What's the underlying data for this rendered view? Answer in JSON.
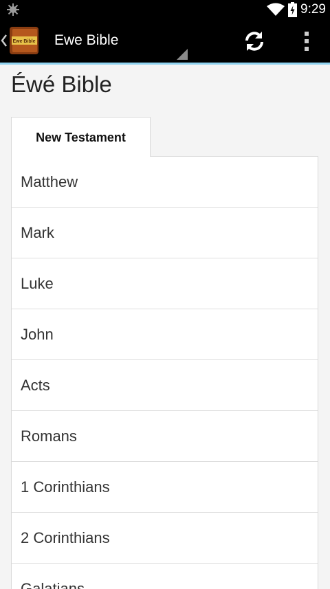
{
  "status_bar": {
    "time": "9:29",
    "icons": [
      "android-debug-icon",
      "wifi-icon",
      "battery-charging-icon"
    ]
  },
  "action_bar": {
    "title": "Ewe Bible",
    "app_icon_text": "Ewe Bible",
    "actions": [
      "refresh-icon",
      "overflow-menu-icon"
    ],
    "accent_color": "#8fd3f0"
  },
  "page": {
    "title": "Éwé Bible"
  },
  "tabs": [
    {
      "label": "New Testament",
      "selected": true
    }
  ],
  "books": [
    "Matthew",
    "Mark",
    "Luke",
    "John",
    "Acts",
    "Romans",
    "1 Corinthians",
    "2 Corinthians",
    "Galatians"
  ]
}
